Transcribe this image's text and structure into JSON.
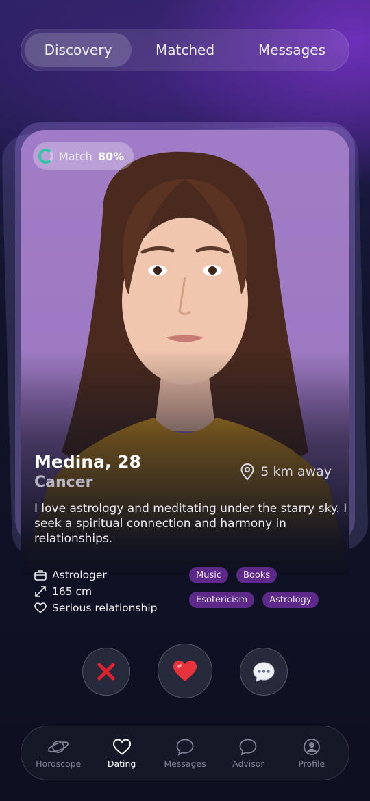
{
  "top_tabs": [
    {
      "label": "Discovery",
      "active": true
    },
    {
      "label": "Matched",
      "active": false
    },
    {
      "label": "Messages",
      "active": false
    }
  ],
  "profile": {
    "match_label": "Match",
    "match_value": "80%",
    "name_age": "Medina, 28",
    "zodiac": "Cancer",
    "distance": "5 km away",
    "bio": "I love astrology and meditating under the starry sky. I seek a spiritual connection and harmony in relationships.",
    "facts": [
      {
        "icon": "briefcase-icon",
        "text": "Astrologer"
      },
      {
        "icon": "height-arrow-icon",
        "text": "165 cm"
      },
      {
        "icon": "heart-outline-icon",
        "text": "Serious relationship"
      }
    ],
    "tags": [
      "Music",
      "Books",
      "Esotericism",
      "Astrology"
    ]
  },
  "actions": [
    {
      "icon": "cross-icon",
      "glyph": "✖"
    },
    {
      "icon": "heart-icon",
      "glyph": "❤"
    },
    {
      "icon": "speech-bubble-icon",
      "glyph": "💬"
    }
  ],
  "bottom_nav": [
    {
      "label": "Horoscope",
      "icon": "planet-icon",
      "active": false
    },
    {
      "label": "Dating",
      "icon": "heart-outline-icon",
      "active": true
    },
    {
      "label": "Messages",
      "icon": "chat-bubble-icon",
      "active": false
    },
    {
      "label": "Advisor",
      "icon": "chat-bubble-icon",
      "active": false
    },
    {
      "label": "Profile",
      "icon": "user-circle-icon",
      "active": false
    }
  ],
  "colors": {
    "accent_purple": "#5d2a8a",
    "match_ring": "#2fc4a6",
    "reject_red": "#e0202a",
    "like_red": "#e8323b"
  }
}
